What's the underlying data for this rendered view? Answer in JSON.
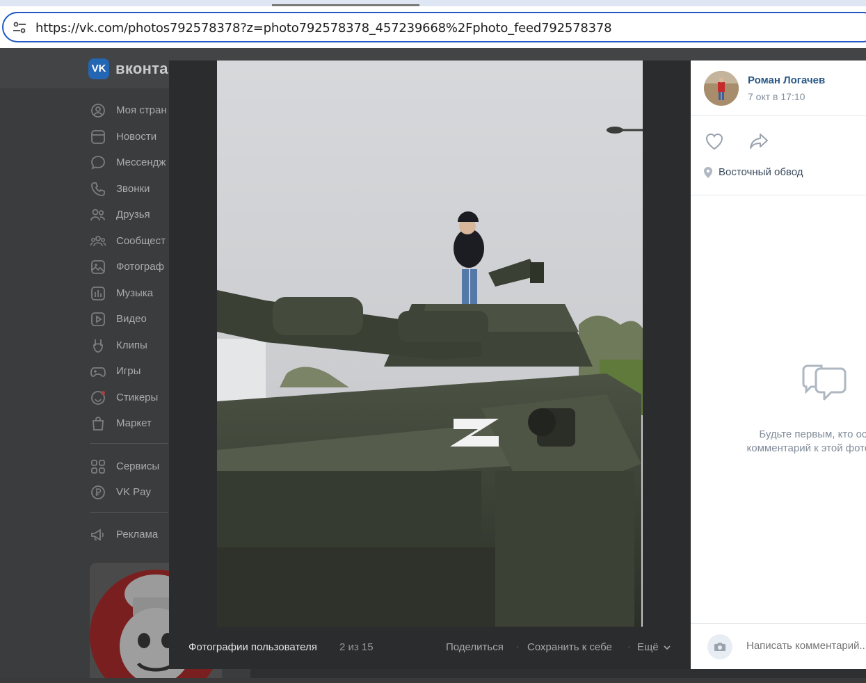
{
  "browser": {
    "url": "https://vk.com/photos792578378?z=photo792578378_457239668%2Fphoto_feed792578378"
  },
  "vk": {
    "logo_text": "VK",
    "brand": "вконта",
    "nav": [
      {
        "label": "Моя стран",
        "icon": "profile-icon"
      },
      {
        "label": "Новости",
        "icon": "news-icon"
      },
      {
        "label": "Мессендж",
        "icon": "messenger-icon"
      },
      {
        "label": "Звонки",
        "icon": "phone-icon"
      },
      {
        "label": "Друзья",
        "icon": "friends-icon"
      },
      {
        "label": "Сообщест",
        "icon": "communities-icon"
      },
      {
        "label": "Фотограф",
        "icon": "photos-icon"
      },
      {
        "label": "Музыка",
        "icon": "music-icon"
      },
      {
        "label": "Видео",
        "icon": "video-icon"
      },
      {
        "label": "Клипы",
        "icon": "clips-icon"
      },
      {
        "label": "Игры",
        "icon": "games-icon"
      },
      {
        "label": "Стикеры",
        "icon": "stickers-icon"
      },
      {
        "label": "Маркет",
        "icon": "market-icon"
      },
      {
        "label": "Сервисы",
        "icon": "services-icon"
      },
      {
        "label": "VK Pay",
        "icon": "vkpay-icon"
      },
      {
        "label": "Реклама",
        "icon": "ads-icon"
      }
    ]
  },
  "viewer": {
    "album_title": "Фотографии пользователя",
    "counter": "2 из 15",
    "actions": {
      "share": "Поделиться",
      "save": "Сохранить к себе",
      "more": "Ещё"
    }
  },
  "panel": {
    "author_name": "Роман Логачев",
    "date": "7 окт в 17:10",
    "location": "Восточный обвод",
    "empty_comments": "Будьте первым, кто оставит комментарий к этой фотографии",
    "comment_placeholder": "Написать комментарий..."
  },
  "colors": {
    "vk_blue": "#2366b4",
    "link": "#2a5885",
    "muted": "#818c99"
  }
}
